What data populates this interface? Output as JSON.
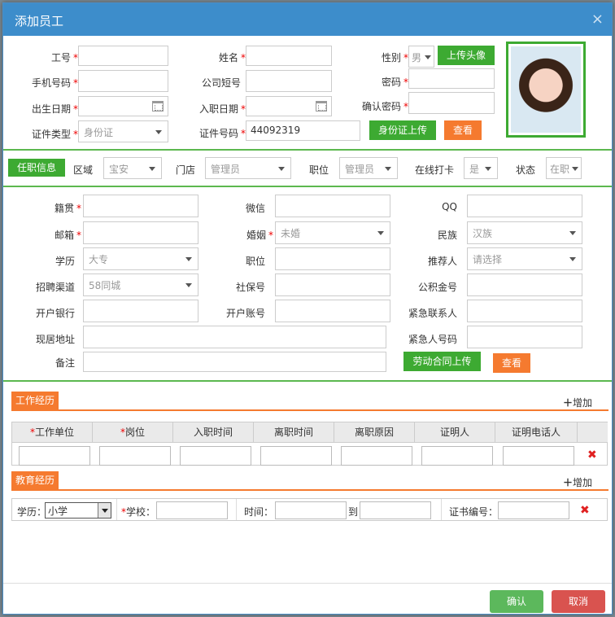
{
  "dialog": {
    "title": "添加员工",
    "close": "×"
  },
  "basic": {
    "emp_no": "工号",
    "name": "姓名",
    "gender": "性别",
    "gender_value": "男",
    "upload_avatar": "上传头像",
    "mobile": "手机号码",
    "short_no": "公司短号",
    "password": "密码",
    "birth": "出生日期",
    "join_date": "入职日期",
    "confirm_pwd": "确认密码",
    "id_type": "证件类型",
    "id_type_value": "身份证",
    "id_no": "证件号码",
    "id_no_value": "44092319",
    "id_upload": "身份证上传",
    "view": "查看"
  },
  "job": {
    "tab": "任职信息",
    "region": "区域",
    "region_value": "宝安",
    "store": "门店",
    "store_value": "管理员",
    "position": "职位",
    "position_value": "管理员",
    "online_punch": "在线打卡",
    "online_value": "是",
    "status": "状态",
    "status_value": "在职"
  },
  "detail": {
    "native": "籍贯",
    "wechat": "微信",
    "qq": "QQ",
    "email": "邮箱",
    "marriage": "婚姻",
    "marriage_value": "未婚",
    "nation": "民族",
    "nation_value": "汉族",
    "education": "学历",
    "education_value": "大专",
    "job_title": "职位",
    "referrer": "推荐人",
    "referrer_value": "请选择",
    "channel": "招聘渠道",
    "channel_value": "58同城",
    "social_no": "社保号",
    "fund_no": "公积金号",
    "bank": "开户银行",
    "account": "开户账号",
    "emergency": "紧急联系人",
    "address": "现居地址",
    "emergency_phone": "紧急人号码",
    "remark": "备注",
    "contract_upload": "劳动合同上传",
    "view": "查看"
  },
  "work": {
    "tab": "工作经历",
    "add": "增加",
    "headers": [
      "*工作单位",
      "*岗位",
      "入职时间",
      "离职时间",
      "离职原因",
      "证明人",
      "证明电话人"
    ],
    "delete": "✖"
  },
  "edu": {
    "tab": "教育经历",
    "add": "增加",
    "level_label": "学历：",
    "level_value": "小学",
    "school_label": "*学校：",
    "time_label": "时间：",
    "to": "到",
    "cert_label": "证书编号：",
    "delete": "✖"
  },
  "footer": {
    "confirm": "确认",
    "cancel": "取消"
  },
  "colors": {
    "green": "#3daa32",
    "orange": "#f57a2f",
    "blue": "#3d8dcb",
    "confirm": "#5cb85c",
    "cancel": "#d9534f"
  }
}
